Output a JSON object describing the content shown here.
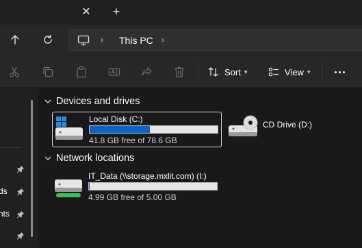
{
  "tabbar": {
    "close_glyph": "✕",
    "new_tab_glyph": "+"
  },
  "nav": {
    "up_icon": "arrow-up-icon",
    "refresh_icon": "refresh-icon"
  },
  "address": {
    "root_icon": "pc-icon",
    "separator": "›",
    "crumbs": [
      "This PC"
    ]
  },
  "toolbar": {
    "icons": [
      "cut-icon",
      "copy-icon",
      "paste-icon",
      "rename-icon",
      "share-icon",
      "delete-icon"
    ],
    "sort_label": "Sort",
    "view_label": "View",
    "more_icon": "more-icon"
  },
  "sidebar": {
    "items": [
      {
        "label": "",
        "pinned": true
      },
      {
        "label": "ds",
        "pinned": true
      },
      {
        "label": "nts",
        "pinned": true
      },
      {
        "label": "",
        "pinned": true
      }
    ]
  },
  "groups": [
    {
      "title": "Devices and drives",
      "drives": [
        {
          "name": "Local Disk (C:)",
          "free_text": "41.8 GB free of 78.6 GB",
          "used_fraction": 0.468,
          "bar_color": "#0b65c8",
          "selected": true,
          "icon": "windows-drive-icon"
        },
        {
          "name": "CD Drive (D:)",
          "free_text": "",
          "icon": "cd-drive-icon"
        }
      ]
    },
    {
      "title": "Network locations",
      "drives": [
        {
          "name": "IT_Data (\\\\storage.mxlit.com) (I:)",
          "free_text": "4.99 GB free of 5.00 GB",
          "used_fraction": 0.002,
          "bar_color": "#0b65c8",
          "icon": "network-drive-icon"
        }
      ]
    }
  ],
  "colors": {
    "accent": "#0b65c8",
    "network_led": "#36c24f"
  }
}
